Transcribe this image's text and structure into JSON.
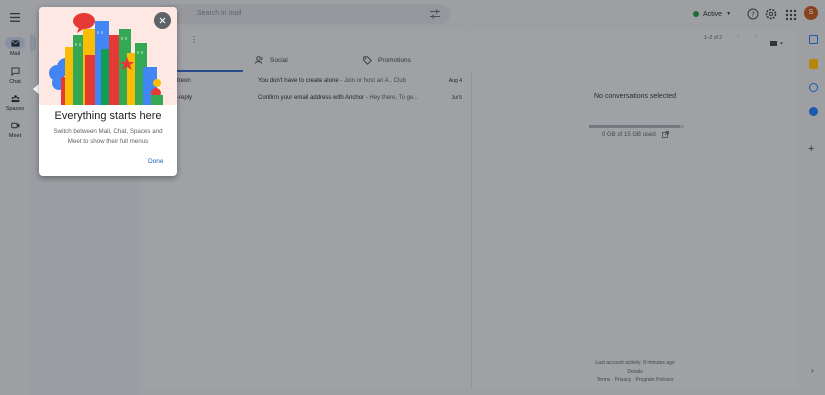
{
  "search": {
    "placeholder": "Search in mail"
  },
  "status": {
    "label": "Active"
  },
  "account": {
    "initial": "S"
  },
  "rail": {
    "items": [
      {
        "label": "Mail",
        "icon": "mail-icon"
      },
      {
        "label": "Chat",
        "icon": "chat-icon"
      },
      {
        "label": "Spaces",
        "icon": "spaces-icon"
      },
      {
        "label": "Meet",
        "icon": "meet-icon"
      }
    ]
  },
  "pager": {
    "text": "1–2 of 2"
  },
  "tabs": {
    "primary": "ry",
    "social": "Social",
    "promotions": "Promotions"
  },
  "emails": [
    {
      "sender": "treon",
      "subject": "You don't have to create alone",
      "snippet": " - Join or host an A.. Club",
      "date": "Aug 4"
    },
    {
      "sender": "-reply",
      "subject": "Confirm your email address with Anchor",
      "snippet": " - Hey there, To ge...",
      "date": "Jul 5"
    }
  ],
  "reading": {
    "empty_text": "No conversations selected",
    "storage_text": "0 GB of 15 GB used"
  },
  "footer": {
    "activity": "Last account activity: 8 minutes ago",
    "details": "Details",
    "links": "Terms · Privacy · Program Policies"
  },
  "popup": {
    "title": "Everything starts here",
    "description": "Switch between Mail, Chat, Spaces and Meet to show their full menus",
    "done_label": "Done"
  },
  "colors": {
    "accent": "#1a5fc4",
    "active_dot": "#1e8e3e",
    "avatar": "#b3521d"
  }
}
